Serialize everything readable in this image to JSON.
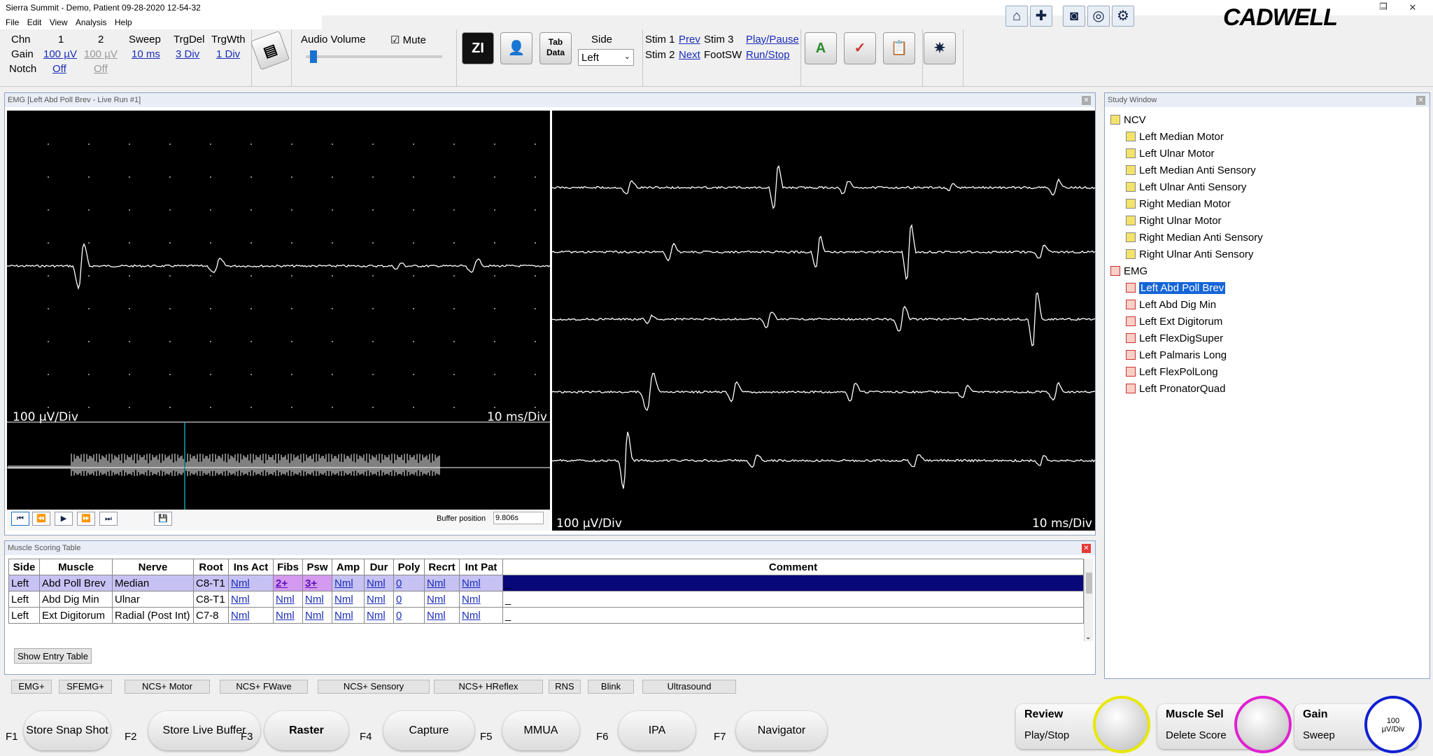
{
  "app": {
    "title": "Sierra Summit - Demo, Patient 09-28-2020 12-54-32",
    "logo": "CADWELL",
    "menu": [
      "File",
      "Edit",
      "View",
      "Analysis",
      "Help"
    ]
  },
  "toolbar": {
    "chn_label": "Chn",
    "gain_label": "Gain",
    "notch_label": "Notch",
    "ch1": "1",
    "ch2": "2",
    "ch1_gain": "100 µV",
    "ch2_gain": "100 µV",
    "ch1_notch": "Off",
    "ch2_notch": "Off",
    "sweep_label": "Sweep",
    "sweep_val": "10 ms",
    "trgdel_label": "TrgDel",
    "trgdel_val": "3 Div",
    "trgwth_label": "TrgWth",
    "trgwth_val": "1 Div",
    "audio_label": "Audio Volume",
    "mute_label": "Mute",
    "audio_level": 0.03,
    "side_label": "Side",
    "side_value": "Left",
    "tabdata_label": "Tab Data",
    "zi_label": "ZI",
    "stim1": "Stim 1",
    "stim2": "Stim 2",
    "stim3": "Stim 3",
    "footsw": "FootSW",
    "prev": "Prev",
    "next": "Next",
    "play_pause": "Play/Pause",
    "run_stop": "Run/Stop"
  },
  "emg_panel": {
    "title": "EMG [Left Abd Poll Brev - Live Run #1]",
    "left_gain": "100 µV/Div",
    "left_sweep": "10 ms/Div",
    "right_gain": "100 µV/Div",
    "right_sweep": "10 ms/Div",
    "buffer_label": "Buffer position",
    "buffer_value": "9.806s"
  },
  "study": {
    "title": "Study Window",
    "groups": [
      {
        "label": "NCV",
        "items": [
          "Left Median Motor",
          "Left Ulnar Motor",
          "Left Median Anti Sensory",
          "Left Ulnar Anti Sensory",
          "Right Median Motor",
          "Right Ulnar Motor",
          "Right Median Anti Sensory",
          "Right Ulnar Anti Sensory"
        ]
      },
      {
        "label": "EMG",
        "items": [
          "Left Abd Poll Brev",
          "Left Abd Dig Min",
          "Left Ext Digitorum",
          "Left FlexDigSuper",
          "Left Palmaris Long",
          "Left FlexPolLong",
          "Left PronatorQuad"
        ]
      }
    ],
    "selected": "Left Abd Poll Brev"
  },
  "scoring": {
    "title": "Muscle Scoring Table",
    "headers": [
      "Side",
      "Muscle",
      "Nerve",
      "Root",
      "Ins Act",
      "Fibs",
      "Psw",
      "Amp",
      "Dur",
      "Poly",
      "Recrt",
      "Int Pat",
      "Comment"
    ],
    "rows": [
      [
        "Left",
        "Abd Poll Brev",
        "Median",
        "C8-T1",
        "Nml",
        "2+",
        "3+",
        "Nml",
        "Nml",
        "0",
        "Nml",
        "Nml",
        "_"
      ],
      [
        "Left",
        "Abd Dig Min",
        "Ulnar",
        "C8-T1",
        "Nml",
        "Nml",
        "Nml",
        "Nml",
        "Nml",
        "0",
        "Nml",
        "Nml",
        "_"
      ],
      [
        "Left",
        "Ext Digitorum",
        "Radial (Post Int)",
        "C7-8",
        "Nml",
        "Nml",
        "Nml",
        "Nml",
        "Nml",
        "0",
        "Nml",
        "Nml",
        "_"
      ]
    ],
    "show_entry": "Show Entry Table"
  },
  "modes": [
    "EMG+",
    "SFEMG+",
    "NCS+ Motor",
    "NCS+ FWave",
    "NCS+ Sensory",
    "NCS+ HReflex",
    "RNS",
    "Blink",
    "Ultrasound"
  ],
  "fkeys": [
    {
      "key": "F1",
      "label": "Store Snap Shot"
    },
    {
      "key": "F2",
      "label": "Store Live Buffer"
    },
    {
      "key": "F3",
      "label": "Raster"
    },
    {
      "key": "F4",
      "label": "Capture"
    },
    {
      "key": "F5",
      "label": "MMUA"
    },
    {
      "key": "F6",
      "label": "IPA"
    },
    {
      "key": "F7",
      "label": "Navigator"
    }
  ],
  "knobs": [
    {
      "top": "Review",
      "bottom": "Play/Stop",
      "color": "#e8e800"
    },
    {
      "top": "Muscle Sel",
      "bottom": "Delete Score",
      "color": "#e020d0"
    },
    {
      "top": "Gain",
      "bottom": "Sweep",
      "color": "#1020d0",
      "center": "100\nµV/Div"
    }
  ]
}
